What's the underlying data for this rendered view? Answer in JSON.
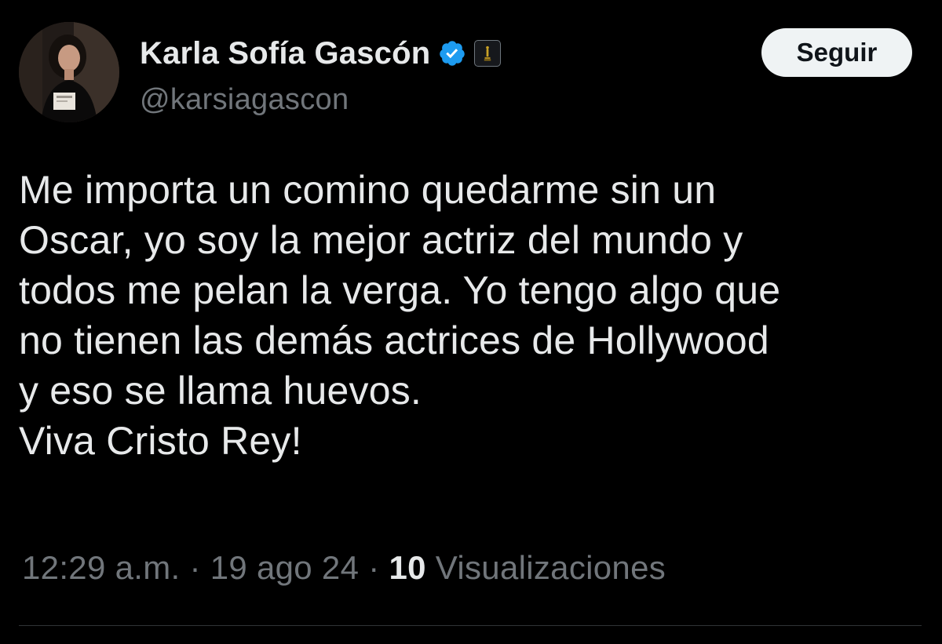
{
  "user": {
    "display_name": "Karla Sofía Gascón",
    "handle": "@karsiagascon",
    "verified_color": "#1d9bf0",
    "affiliate_badge_icon": "oscar-statuette-icon"
  },
  "actions": {
    "follow_label": "Seguir"
  },
  "tweet": {
    "lines": [
      "Me importa un comino quedarme sin un",
      "Oscar, yo soy la mejor actriz del mundo y",
      "todos me pelan la verga. Yo tengo algo que",
      "no tienen las demás actrices de Hollywood",
      "y eso se llama huevos.",
      "Viva Cristo Rey!"
    ]
  },
  "meta": {
    "time": "12:29 a.m.",
    "separator": " · ",
    "date": "19 ago 24",
    "views_count": "10",
    "views_label": "Visualizaciones"
  },
  "colors": {
    "background": "#000000",
    "text_primary": "#e7e9ea",
    "text_secondary": "#71767b",
    "button_bg": "#eff3f4",
    "button_text": "#0f1419"
  }
}
